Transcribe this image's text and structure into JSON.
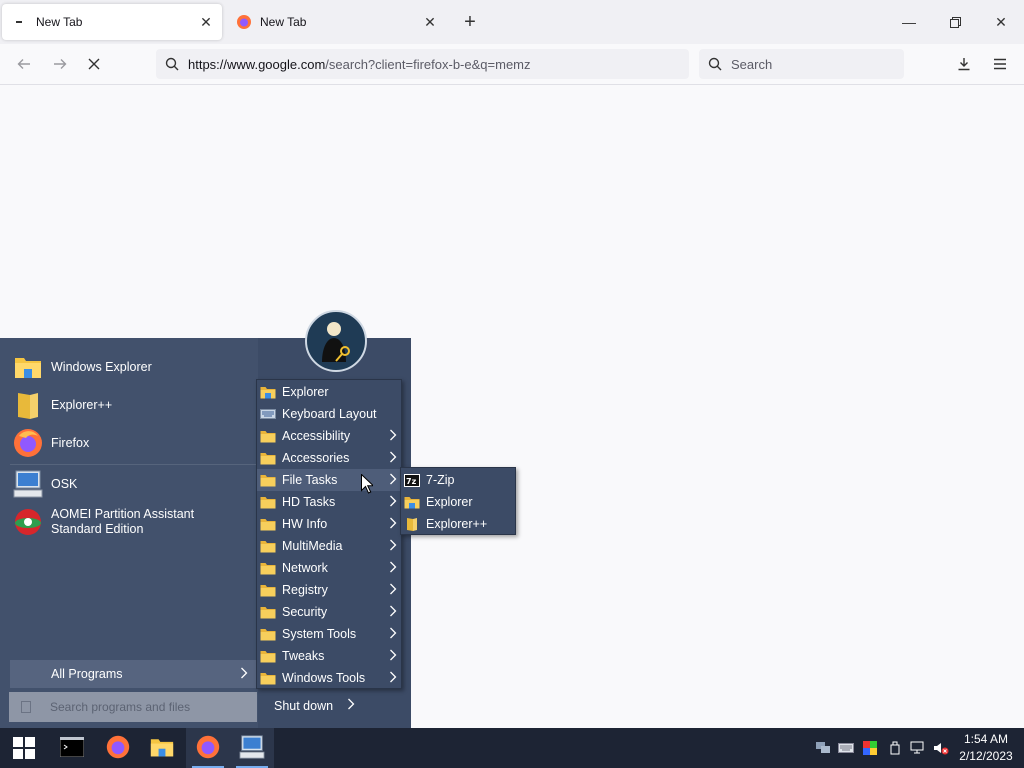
{
  "browser": {
    "tabs": [
      {
        "title": "New Tab",
        "active": true,
        "icon": "loading-dot-icon"
      },
      {
        "title": "New Tab",
        "active": false,
        "icon": "firefox-icon"
      }
    ],
    "url": {
      "host": "https://www.google.com",
      "path": "/search?client=firefox-b-e&q=memz"
    },
    "search_placeholder": "Search"
  },
  "start_menu": {
    "pinned": [
      {
        "label": "Windows Explorer",
        "icon": "folder-icon"
      },
      {
        "label": "Explorer++",
        "icon": "explorerpp-icon"
      },
      {
        "label": "Firefox",
        "icon": "firefox-icon"
      },
      {
        "label": "OSK",
        "icon": "osk-icon"
      },
      {
        "label": "AOMEI Partition Assistant",
        "label2": "Standard Edition",
        "icon": "aomei-icon"
      }
    ],
    "all_programs": "All Programs",
    "search_placeholder": "Search programs and files",
    "shutdown": "Shut down",
    "programs": [
      {
        "label": "Explorer",
        "icon": "explorer-folder-icon",
        "submenu": false
      },
      {
        "label": "Keyboard Layout",
        "icon": "keyboard-icon",
        "submenu": false
      },
      {
        "label": "Accessibility",
        "icon": "folder-icon",
        "submenu": true
      },
      {
        "label": "Accessories",
        "icon": "folder-icon",
        "submenu": true
      },
      {
        "label": "File Tasks",
        "icon": "folder-icon",
        "submenu": true,
        "highlighted": true
      },
      {
        "label": "HD Tasks",
        "icon": "folder-icon",
        "submenu": true
      },
      {
        "label": "HW Info",
        "icon": "folder-icon",
        "submenu": true
      },
      {
        "label": "MultiMedia",
        "icon": "folder-icon",
        "submenu": true
      },
      {
        "label": "Network",
        "icon": "folder-icon",
        "submenu": true
      },
      {
        "label": "Registry",
        "icon": "folder-icon",
        "submenu": true
      },
      {
        "label": "Security",
        "icon": "folder-icon",
        "submenu": true
      },
      {
        "label": "System Tools",
        "icon": "folder-icon",
        "submenu": true
      },
      {
        "label": "Tweaks",
        "icon": "folder-icon",
        "submenu": true
      },
      {
        "label": "Windows Tools",
        "icon": "folder-icon",
        "submenu": true
      }
    ],
    "file_tasks": [
      {
        "label": "7-Zip",
        "icon": "7zip-icon"
      },
      {
        "label": "Explorer",
        "icon": "explorer-folder-icon"
      },
      {
        "label": "Explorer++",
        "icon": "explorerpp-icon"
      }
    ]
  },
  "taskbar": {
    "apps": [
      "terminal-icon",
      "firefox-icon",
      "file-explorer-icon",
      "firefox-icon",
      "osk-icon"
    ],
    "clock": {
      "time": "1:54 AM",
      "date": "2/12/2023"
    }
  },
  "colors": {
    "menu_bg": "#3c4b66",
    "taskbar_bg": "#1d2434",
    "folder": "#f5c542"
  }
}
